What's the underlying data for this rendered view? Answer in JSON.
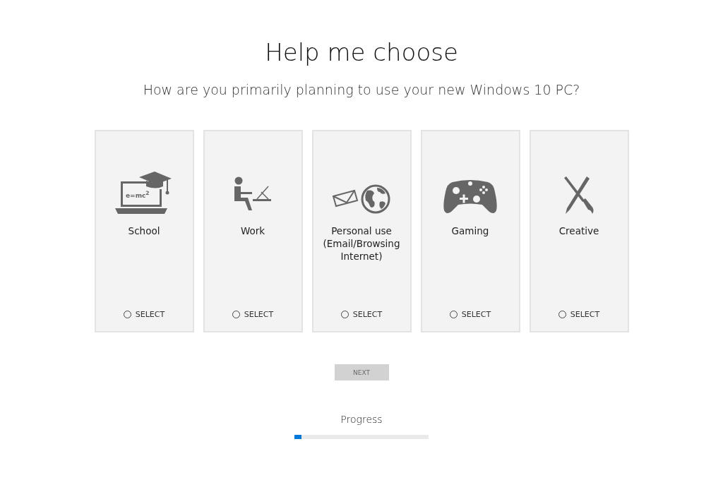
{
  "title": "Help me choose",
  "question": "How are you primarily planning to use your new Windows 10 PC?",
  "options": [
    {
      "kind": "school",
      "label": "School",
      "icon_text": "e=mc$^{2}$",
      "select": "SELECT",
      "selected": false
    },
    {
      "kind": "work",
      "label": "Work",
      "select": "SELECT",
      "selected": false
    },
    {
      "kind": "personal",
      "label": "Personal use (Email/Browsing Internet)",
      "select": "SELECT",
      "selected": false
    },
    {
      "kind": "gaming",
      "label": "Gaming",
      "select": "SELECT",
      "selected": false
    },
    {
      "kind": "creative",
      "label": "Creative",
      "select": "SELECT",
      "selected": false
    }
  ],
  "next_button": {
    "label": "NEXT",
    "disabled": true
  },
  "progress": {
    "label": "Progress",
    "level": 0.05
  }
}
